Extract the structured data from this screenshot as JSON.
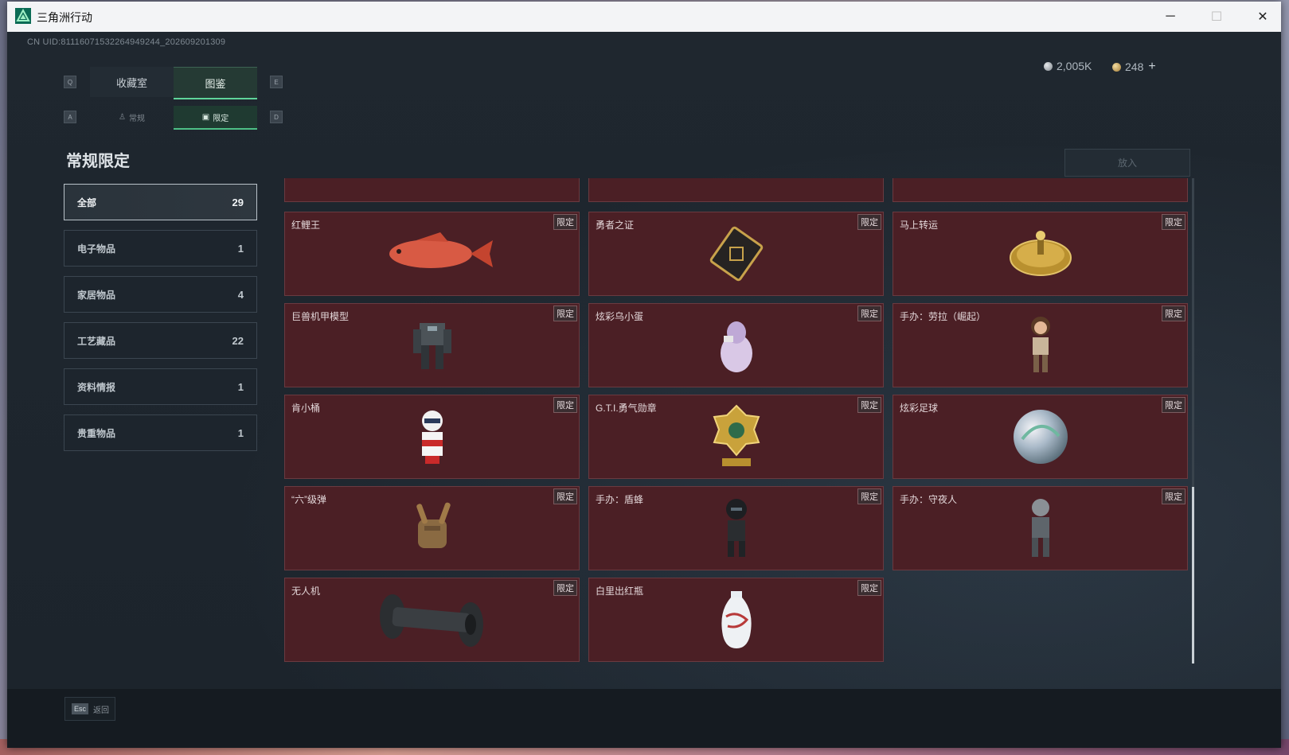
{
  "window": {
    "title": "三角洲行动",
    "minimize": "─",
    "maximize": "☐",
    "close": "✕"
  },
  "uid": "CN UID:81116071532264949244_202609201309",
  "currency": {
    "silver": "2,005K",
    "gold": "248",
    "add": "+"
  },
  "key_hints": {
    "prev_tab": "Q",
    "next_tab": "E",
    "prev_subtab": "A",
    "next_subtab": "D"
  },
  "tabs": [
    {
      "label": "收藏室"
    },
    {
      "label": "图鉴"
    }
  ],
  "subtabs": [
    {
      "label": "常规"
    },
    {
      "label": "限定"
    }
  ],
  "section_title": "常规限定",
  "put_button": "放入",
  "categories": [
    {
      "label": "全部",
      "count": "29"
    },
    {
      "label": "电子物品",
      "count": "1"
    },
    {
      "label": "家居物品",
      "count": "4"
    },
    {
      "label": "工艺藏品",
      "count": "22"
    },
    {
      "label": "资料情报",
      "count": "1"
    },
    {
      "label": "贵重物品",
      "count": "1"
    }
  ],
  "limited_tag": "限定",
  "items": [
    {
      "name": "红鲤王"
    },
    {
      "name": "勇者之证"
    },
    {
      "name": "马上转运"
    },
    {
      "name": "巨兽机甲模型"
    },
    {
      "name": "炫彩乌小蛋"
    },
    {
      "name": "手办：劳拉（崛起）"
    },
    {
      "name": "肯小桶"
    },
    {
      "name": "G.T.I.勇气勋章"
    },
    {
      "name": "炫彩足球"
    },
    {
      "name": "“六”级弹"
    },
    {
      "name": "手办：盾蜂"
    },
    {
      "name": "手办：守夜人"
    },
    {
      "name": "无人机"
    },
    {
      "name": "白里出红瓶"
    }
  ],
  "footer": {
    "esc_key": "Esc",
    "esc_label": "返回"
  },
  "colors": {
    "accent": "#5fd59a",
    "card_bg": "#4b1f25",
    "card_border": "#6a3a40"
  }
}
